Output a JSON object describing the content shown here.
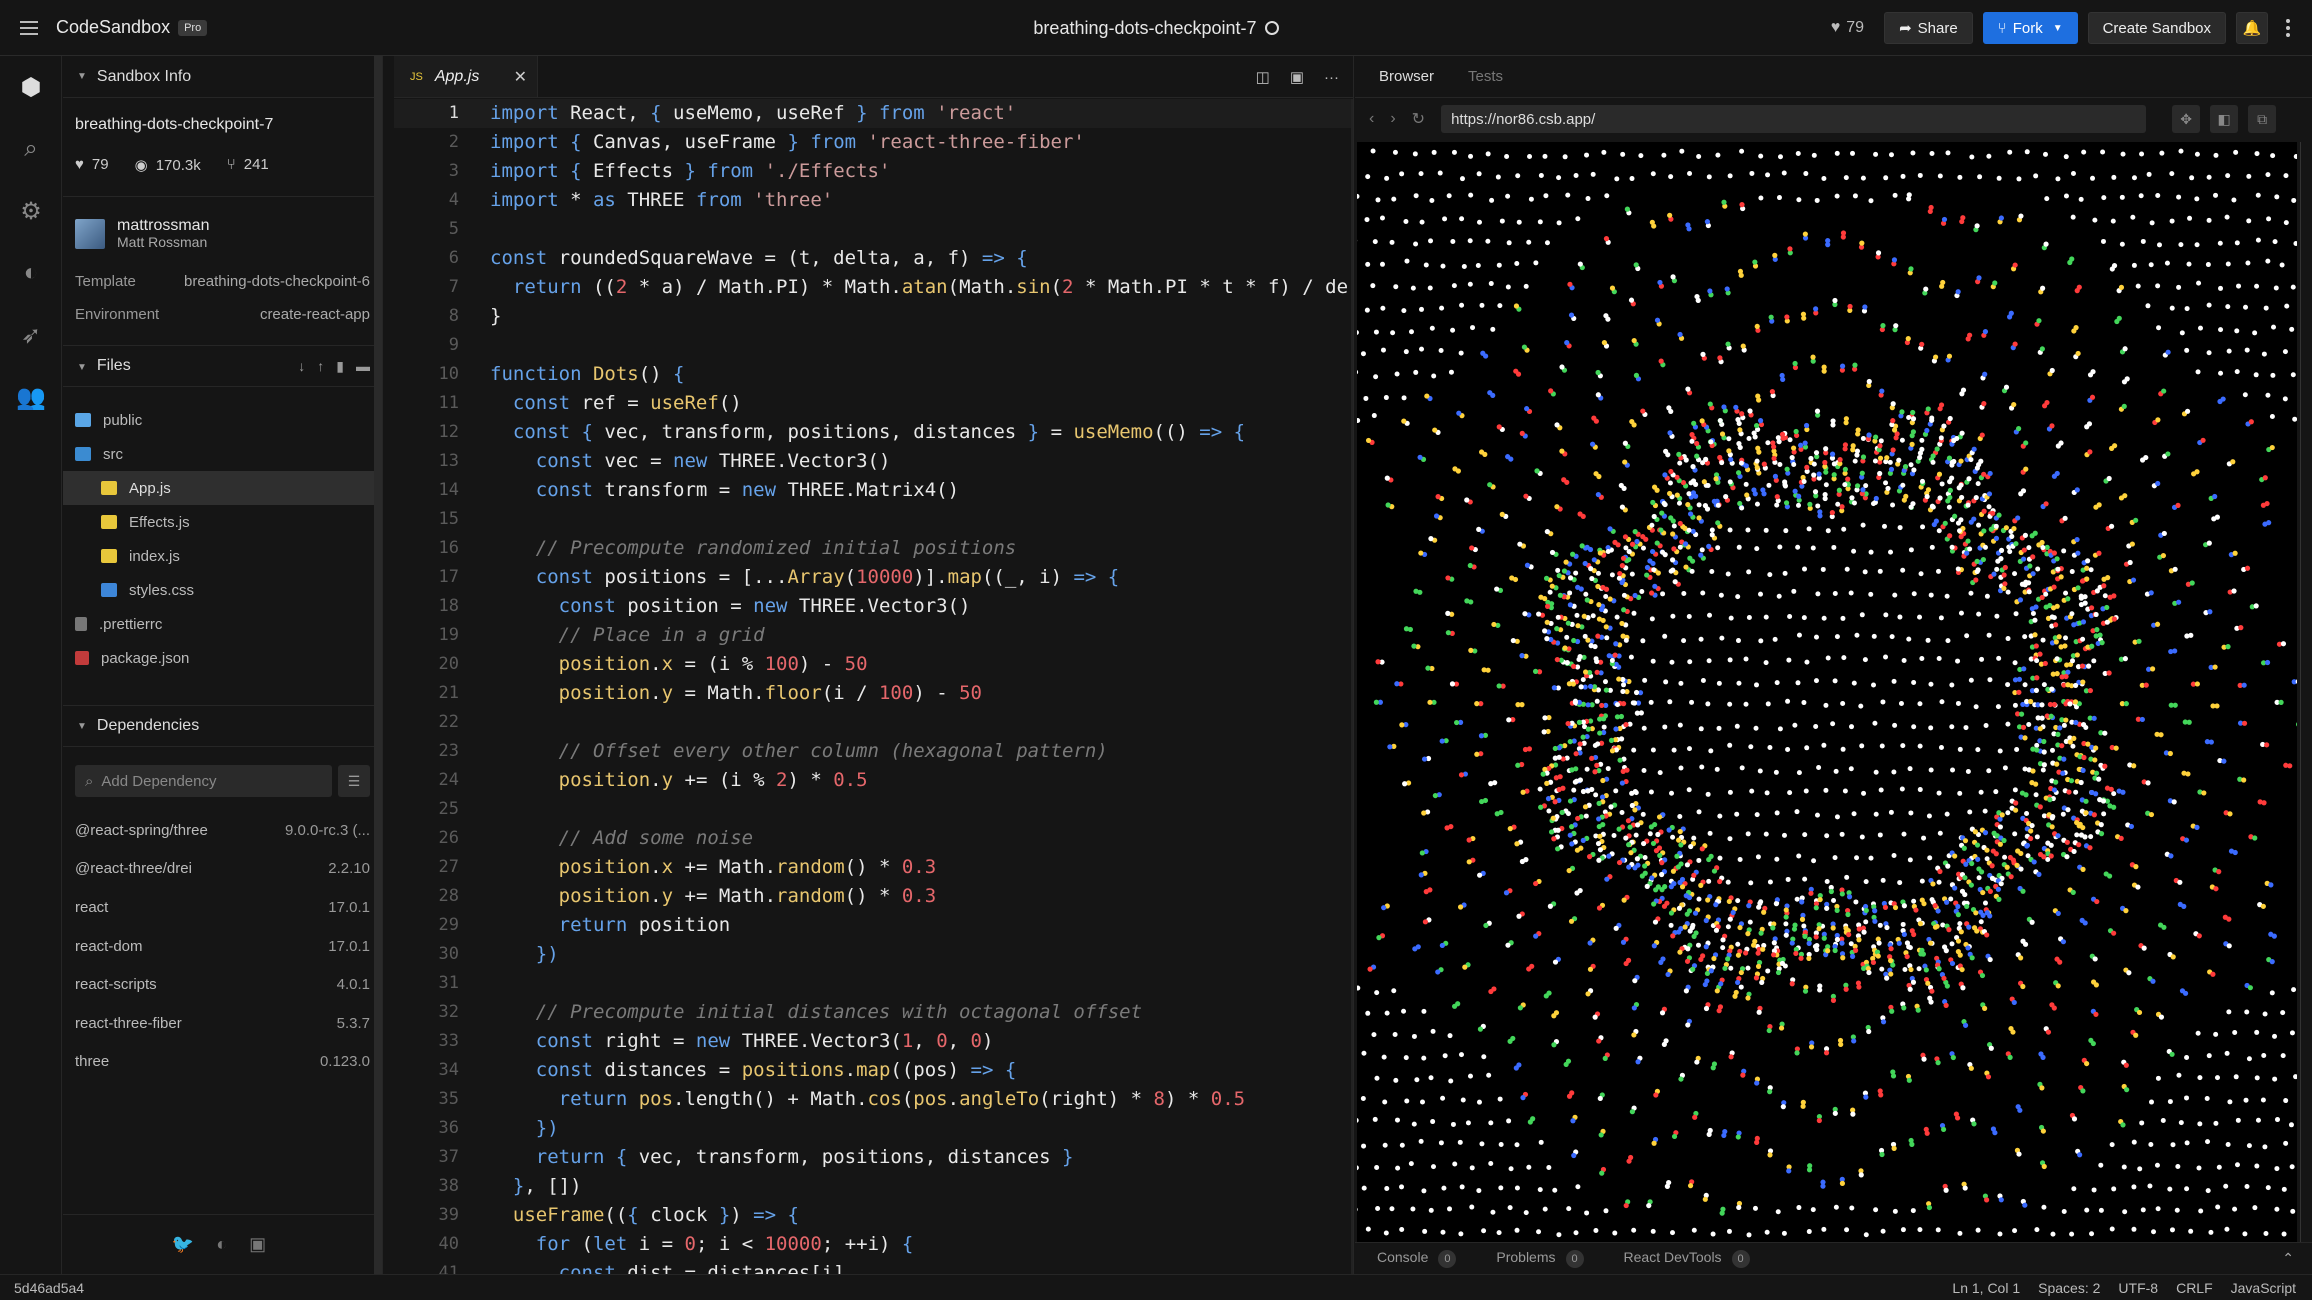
{
  "header": {
    "brand": "CodeSandbox",
    "pro_badge": "Pro",
    "title": "breathing-dots-checkpoint-7",
    "likes": "79",
    "share_label": "Share",
    "fork_label": "Fork",
    "create_label": "Create Sandbox"
  },
  "sidebar": {
    "info_header": "Sandbox Info",
    "sandbox_name": "breathing-dots-checkpoint-7",
    "stats": {
      "likes": "79",
      "views": "170.3k",
      "forks": "241"
    },
    "author": {
      "username": "mattrossman",
      "name": "Matt Rossman"
    },
    "template_label": "Template",
    "template_value": "breathing-dots-checkpoint-6",
    "environment_label": "Environment",
    "environment_value": "create-react-app",
    "files_header": "Files",
    "files": [
      {
        "name": "public",
        "type": "folder",
        "indent": 0
      },
      {
        "name": "src",
        "type": "folder-open",
        "indent": 0
      },
      {
        "name": "App.js",
        "type": "js",
        "indent": 1,
        "active": true
      },
      {
        "name": "Effects.js",
        "type": "js",
        "indent": 1
      },
      {
        "name": "index.js",
        "type": "js",
        "indent": 1
      },
      {
        "name": "styles.css",
        "type": "css",
        "indent": 1
      },
      {
        "name": ".prettierrc",
        "type": "pret",
        "indent": 0
      },
      {
        "name": "package.json",
        "type": "pkg",
        "indent": 0
      }
    ],
    "deps_header": "Dependencies",
    "add_dependency_placeholder": "Add Dependency",
    "dependencies": [
      {
        "name": "@react-spring/three",
        "version": "9.0.0-rc.3 (..."
      },
      {
        "name": "@react-three/drei",
        "version": "2.2.10"
      },
      {
        "name": "react",
        "version": "17.0.1"
      },
      {
        "name": "react-dom",
        "version": "17.0.1"
      },
      {
        "name": "react-scripts",
        "version": "4.0.1"
      },
      {
        "name": "react-three-fiber",
        "version": "5.3.7"
      },
      {
        "name": "three",
        "version": "0.123.0"
      }
    ]
  },
  "editor": {
    "tab_icon": "JS",
    "tab_label": "App.js",
    "lines": [
      [
        [
          "k",
          "import "
        ],
        [
          "t",
          "React, "
        ],
        [
          "k",
          "{ "
        ],
        [
          "t",
          "useMemo, useRef "
        ],
        [
          "k",
          "} from "
        ],
        [
          "s",
          "'react'"
        ]
      ],
      [
        [
          "k",
          "import "
        ],
        [
          "k",
          "{ "
        ],
        [
          "t",
          "Canvas, useFrame "
        ],
        [
          "k",
          "} from "
        ],
        [
          "s",
          "'react-three-fiber'"
        ]
      ],
      [
        [
          "k",
          "import "
        ],
        [
          "k",
          "{ "
        ],
        [
          "t",
          "Effects "
        ],
        [
          "k",
          "} from "
        ],
        [
          "s",
          "'./Effects'"
        ]
      ],
      [
        [
          "k",
          "import "
        ],
        [
          "t",
          "* "
        ],
        [
          "k",
          "as "
        ],
        [
          "t",
          "THREE "
        ],
        [
          "k",
          "from "
        ],
        [
          "s",
          "'three'"
        ]
      ],
      [],
      [
        [
          "k",
          "const "
        ],
        [
          "t",
          "roundedSquareWave = (t, delta, a, f) "
        ],
        [
          "k",
          "=> {"
        ]
      ],
      [
        [
          "t",
          "  "
        ],
        [
          "k",
          "return "
        ],
        [
          "t",
          "(("
        ],
        [
          "n",
          "2"
        ],
        [
          "t",
          " * a) / Math.PI) * Math."
        ],
        [
          "f",
          "atan"
        ],
        [
          "t",
          "(Math."
        ],
        [
          "f",
          "sin"
        ],
        [
          "t",
          "("
        ],
        [
          "n",
          "2"
        ],
        [
          "t",
          " * Math.PI * t * f) / de"
        ]
      ],
      [
        [
          "t",
          "}"
        ]
      ],
      [],
      [
        [
          "k",
          "function "
        ],
        [
          "f",
          "Dots"
        ],
        [
          "t",
          "() "
        ],
        [
          "k",
          "{"
        ]
      ],
      [
        [
          "t",
          "  "
        ],
        [
          "k",
          "const "
        ],
        [
          "t",
          "ref = "
        ],
        [
          "f",
          "useRef"
        ],
        [
          "t",
          "()"
        ]
      ],
      [
        [
          "t",
          "  "
        ],
        [
          "k",
          "const "
        ],
        [
          "k",
          "{ "
        ],
        [
          "t",
          "vec, transform, positions, distances "
        ],
        [
          "k",
          "} "
        ],
        [
          "t",
          "= "
        ],
        [
          "f",
          "useMemo"
        ],
        [
          "t",
          "(() "
        ],
        [
          "k",
          "=> {"
        ]
      ],
      [
        [
          "t",
          "    "
        ],
        [
          "k",
          "const "
        ],
        [
          "t",
          "vec = "
        ],
        [
          "k",
          "new "
        ],
        [
          "t",
          "THREE.Vector3()"
        ]
      ],
      [
        [
          "t",
          "    "
        ],
        [
          "k",
          "const "
        ],
        [
          "t",
          "transform = "
        ],
        [
          "k",
          "new "
        ],
        [
          "t",
          "THREE.Matrix4()"
        ]
      ],
      [],
      [
        [
          "t",
          "    "
        ],
        [
          "c",
          "// Precompute randomized initial positions"
        ]
      ],
      [
        [
          "t",
          "    "
        ],
        [
          "k",
          "const "
        ],
        [
          "t",
          "positions = [..."
        ],
        [
          "f",
          "Array"
        ],
        [
          "t",
          "("
        ],
        [
          "n",
          "10000"
        ],
        [
          "t",
          ")]."
        ],
        [
          "f",
          "map"
        ],
        [
          "t",
          "((_, i) "
        ],
        [
          "k",
          "=> {"
        ]
      ],
      [
        [
          "t",
          "      "
        ],
        [
          "k",
          "const "
        ],
        [
          "t",
          "position = "
        ],
        [
          "k",
          "new "
        ],
        [
          "t",
          "THREE.Vector3()"
        ]
      ],
      [
        [
          "t",
          "      "
        ],
        [
          "c",
          "// Place in a grid"
        ]
      ],
      [
        [
          "t",
          "      "
        ],
        [
          "f",
          "position"
        ],
        [
          "t",
          "."
        ],
        [
          "f",
          "x"
        ],
        [
          "t",
          " = (i % "
        ],
        [
          "n",
          "100"
        ],
        [
          "t",
          ") - "
        ],
        [
          "n",
          "50"
        ]
      ],
      [
        [
          "t",
          "      "
        ],
        [
          "f",
          "position"
        ],
        [
          "t",
          "."
        ],
        [
          "f",
          "y"
        ],
        [
          "t",
          " = Math."
        ],
        [
          "f",
          "floor"
        ],
        [
          "t",
          "(i / "
        ],
        [
          "n",
          "100"
        ],
        [
          "t",
          ") - "
        ],
        [
          "n",
          "50"
        ]
      ],
      [],
      [
        [
          "t",
          "      "
        ],
        [
          "c",
          "// Offset every other column (hexagonal pattern)"
        ]
      ],
      [
        [
          "t",
          "      "
        ],
        [
          "f",
          "position"
        ],
        [
          "t",
          "."
        ],
        [
          "f",
          "y"
        ],
        [
          "t",
          " += (i % "
        ],
        [
          "n",
          "2"
        ],
        [
          "t",
          ") * "
        ],
        [
          "n",
          "0.5"
        ]
      ],
      [],
      [
        [
          "t",
          "      "
        ],
        [
          "c",
          "// Add some noise"
        ]
      ],
      [
        [
          "t",
          "      "
        ],
        [
          "f",
          "position"
        ],
        [
          "t",
          "."
        ],
        [
          "f",
          "x"
        ],
        [
          "t",
          " += Math."
        ],
        [
          "f",
          "random"
        ],
        [
          "t",
          "() * "
        ],
        [
          "n",
          "0.3"
        ]
      ],
      [
        [
          "t",
          "      "
        ],
        [
          "f",
          "position"
        ],
        [
          "t",
          "."
        ],
        [
          "f",
          "y"
        ],
        [
          "t",
          " += Math."
        ],
        [
          "f",
          "random"
        ],
        [
          "t",
          "() * "
        ],
        [
          "n",
          "0.3"
        ]
      ],
      [
        [
          "t",
          "      "
        ],
        [
          "k",
          "return "
        ],
        [
          "t",
          "position"
        ]
      ],
      [
        [
          "t",
          "    "
        ],
        [
          "k",
          "})"
        ]
      ],
      [],
      [
        [
          "t",
          "    "
        ],
        [
          "c",
          "// Precompute initial distances with octagonal offset"
        ]
      ],
      [
        [
          "t",
          "    "
        ],
        [
          "k",
          "const "
        ],
        [
          "t",
          "right = "
        ],
        [
          "k",
          "new "
        ],
        [
          "t",
          "THREE.Vector3("
        ],
        [
          "n",
          "1"
        ],
        [
          "t",
          ", "
        ],
        [
          "n",
          "0"
        ],
        [
          "t",
          ", "
        ],
        [
          "n",
          "0"
        ],
        [
          "t",
          ")"
        ]
      ],
      [
        [
          "t",
          "    "
        ],
        [
          "k",
          "const "
        ],
        [
          "t",
          "distances = "
        ],
        [
          "f",
          "positions"
        ],
        [
          "t",
          "."
        ],
        [
          "f",
          "map"
        ],
        [
          "t",
          "((pos) "
        ],
        [
          "k",
          "=> {"
        ]
      ],
      [
        [
          "t",
          "      "
        ],
        [
          "k",
          "return "
        ],
        [
          "f",
          "pos"
        ],
        [
          "t",
          ".length() + Math."
        ],
        [
          "f",
          "cos"
        ],
        [
          "t",
          "("
        ],
        [
          "f",
          "pos"
        ],
        [
          "t",
          "."
        ],
        [
          "f",
          "angleTo"
        ],
        [
          "t",
          "(right) * "
        ],
        [
          "n",
          "8"
        ],
        [
          "t",
          ") * "
        ],
        [
          "n",
          "0.5"
        ]
      ],
      [
        [
          "t",
          "    "
        ],
        [
          "k",
          "})"
        ]
      ],
      [
        [
          "t",
          "    "
        ],
        [
          "k",
          "return "
        ],
        [
          "k",
          "{ "
        ],
        [
          "t",
          "vec, transform, positions, distances "
        ],
        [
          "k",
          "}"
        ]
      ],
      [
        [
          "t",
          "  "
        ],
        [
          "k",
          "}"
        ],
        [
          "t",
          ", [])"
        ]
      ],
      [
        [
          "t",
          "  "
        ],
        [
          "f",
          "useFrame"
        ],
        [
          "t",
          "(("
        ],
        [
          "k",
          "{ "
        ],
        [
          "t",
          "clock "
        ],
        [
          "k",
          "}"
        ],
        [
          "t",
          ") "
        ],
        [
          "k",
          "=> {"
        ]
      ],
      [
        [
          "t",
          "    "
        ],
        [
          "k",
          "for "
        ],
        [
          "t",
          "("
        ],
        [
          "k",
          "let "
        ],
        [
          "t",
          "i = "
        ],
        [
          "n",
          "0"
        ],
        [
          "t",
          "; i < "
        ],
        [
          "n",
          "10000"
        ],
        [
          "t",
          "; ++i) "
        ],
        [
          "k",
          "{"
        ]
      ],
      [
        [
          "t",
          "      "
        ],
        [
          "k",
          "const "
        ],
        [
          "t",
          "dist = distances[i]"
        ]
      ]
    ]
  },
  "preview": {
    "tab_browser": "Browser",
    "tab_tests": "Tests",
    "url": "https://nor86.csb.app/",
    "console_tabs": [
      {
        "label": "Console",
        "count": "0"
      },
      {
        "label": "Problems",
        "count": "0"
      },
      {
        "label": "React DevTools",
        "count": "0"
      }
    ]
  },
  "status": {
    "hash": "5d46ad5a4",
    "position": "Ln 1, Col 1",
    "spaces": "Spaces: 2",
    "encoding": "UTF-8",
    "eol": "CRLF",
    "language": "JavaScript"
  },
  "colors": {
    "accent": "#1e6fe0",
    "keyword": "#66a2e9",
    "string": "#cc9b9b",
    "number": "#e5676b",
    "comment": "#7a7a7a",
    "function": "#e8c66f"
  }
}
